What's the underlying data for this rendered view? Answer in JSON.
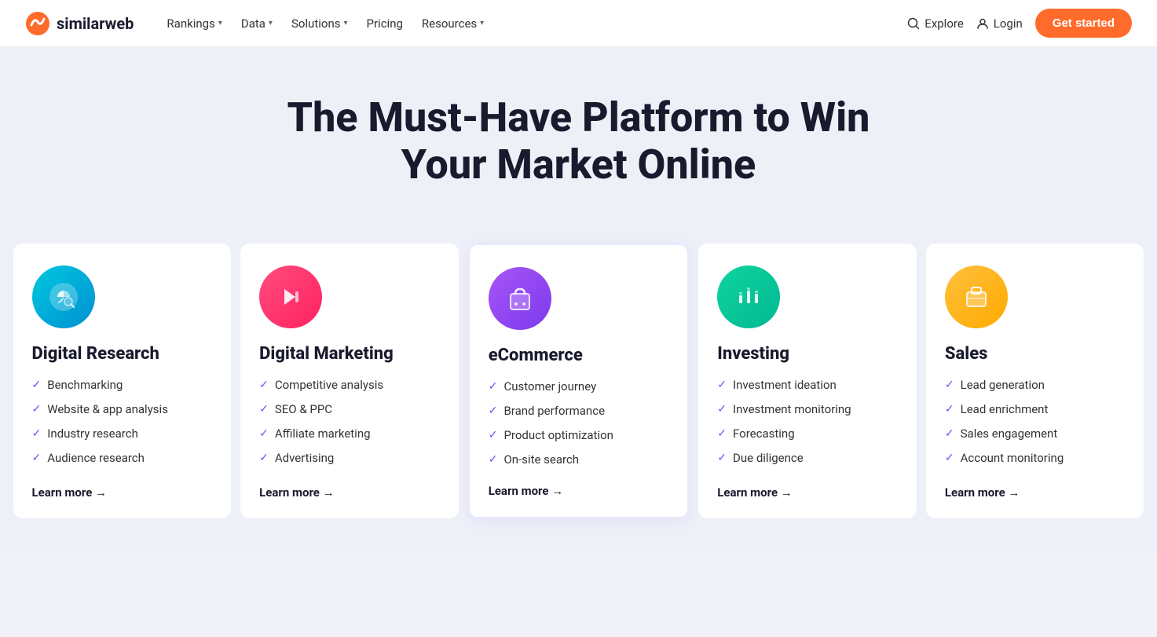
{
  "nav": {
    "logo_text": "similarweb",
    "links": [
      {
        "label": "Rankings",
        "has_dropdown": true
      },
      {
        "label": "Data",
        "has_dropdown": true
      },
      {
        "label": "Solutions",
        "has_dropdown": true
      },
      {
        "label": "Pricing",
        "has_dropdown": false
      },
      {
        "label": "Resources",
        "has_dropdown": true
      }
    ],
    "explore_label": "Explore",
    "login_label": "Login",
    "cta_label": "Get started"
  },
  "hero": {
    "heading": "The Must-Have Platform to Win Your Market Online"
  },
  "cards": [
    {
      "id": "digital-research",
      "icon_type": "research",
      "title": "Digital Research",
      "items": [
        "Benchmarking",
        "Website & app analysis",
        "Industry research",
        "Audience research"
      ],
      "learn_more": "Learn more →",
      "highlighted": false
    },
    {
      "id": "digital-marketing",
      "icon_type": "marketing",
      "title": "Digital Marketing",
      "items": [
        "Competitive analysis",
        "SEO & PPC",
        "Affiliate marketing",
        "Advertising"
      ],
      "learn_more": "Learn more →",
      "highlighted": false
    },
    {
      "id": "ecommerce",
      "icon_type": "ecommerce",
      "title": "eCommerce",
      "items": [
        "Customer journey",
        "Brand performance",
        "Product optimization",
        "On-site search"
      ],
      "learn_more": "Learn more →",
      "highlighted": true
    },
    {
      "id": "investing",
      "icon_type": "investing",
      "title": "Investing",
      "items": [
        "Investment ideation",
        "Investment monitoring",
        "Forecasting",
        "Due diligence"
      ],
      "learn_more": "Learn more →",
      "highlighted": false
    },
    {
      "id": "sales",
      "icon_type": "sales",
      "title": "Sales",
      "items": [
        "Lead generation",
        "Lead enrichment",
        "Sales engagement",
        "Account monitoring"
      ],
      "learn_more": "Learn more →",
      "highlighted": false
    }
  ]
}
